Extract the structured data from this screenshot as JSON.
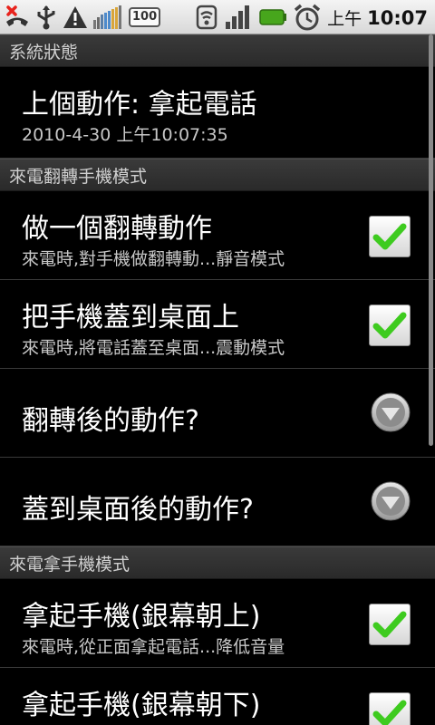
{
  "status_bar": {
    "battery_text": "100",
    "ampm": "上午",
    "time": "10:07",
    "icons": [
      "missed-call-icon",
      "usb-icon",
      "warning-icon",
      "signal-bars-icon",
      "battery-badge-icon",
      "wifi-icon",
      "cell-signal-icon",
      "battery-icon",
      "alarm-clock-icon"
    ]
  },
  "sections": [
    {
      "title": "系統狀態"
    },
    {
      "title": "來電翻轉手機模式"
    },
    {
      "title": "來電拿手機模式"
    }
  ],
  "status_item": {
    "title": "上個動作: 拿起電話",
    "subtitle": "2010-4-30 上午10:07:35"
  },
  "flip_items": [
    {
      "title": "做一個翻轉動作",
      "subtitle": "來電時,對手機做翻轉動...靜音模式",
      "checked": true
    },
    {
      "title": "把手機蓋到桌面上",
      "subtitle": "來電時,將電話蓋至桌面...震動模式",
      "checked": true
    },
    {
      "title": "翻轉後的動作?"
    },
    {
      "title": "蓋到桌面後的動作?"
    }
  ],
  "pickup_items": [
    {
      "title": "拿起手機(銀幕朝上)",
      "subtitle": "來電時,從正面拿起電話...降低音量",
      "checked": true
    },
    {
      "title": "拿起手機(銀幕朝下)",
      "checked": true
    }
  ],
  "colors": {
    "check_green": "#3ecb1f",
    "section_bg": "#333333",
    "background": "#000000"
  }
}
